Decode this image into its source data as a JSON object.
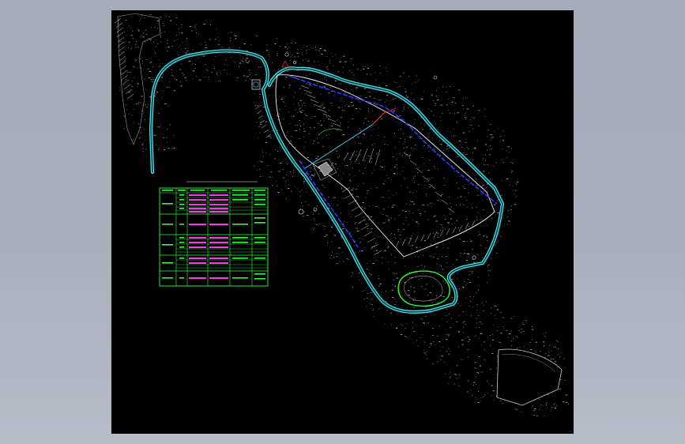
{
  "drawing": {
    "background": "#000000",
    "canvas_gradient": [
      "#a5abb8",
      "#b7bcc7"
    ],
    "colors": {
      "road": "#3fe3ea",
      "road_inner": "#1d6a7a",
      "drain": "#2a3cff",
      "terrain": "#d9d9d9",
      "table": "#2bff3a",
      "table_text": "#ff36f0",
      "red": "#ff2a2a"
    },
    "labels": {
      "table_title": "",
      "site_center": "",
      "site_main": "",
      "pond": "",
      "north_arrow": ""
    }
  },
  "table": {
    "rows": [
      {
        "cells": [
          "",
          "",
          "",
          "",
          "",
          ""
        ]
      },
      {
        "cells": [
          "",
          "",
          "",
          "",
          "",
          ""
        ]
      },
      {
        "cells": [
          "",
          "",
          "",
          "",
          "",
          ""
        ]
      },
      {
        "cells": [
          "",
          "",
          "",
          "",
          "",
          ""
        ]
      },
      {
        "cells": [
          "",
          "",
          "",
          "",
          "",
          ""
        ]
      },
      {
        "cells": [
          "",
          "",
          "",
          "",
          "",
          ""
        ]
      },
      {
        "cells": [
          "",
          "",
          "",
          "",
          "",
          ""
        ]
      }
    ]
  }
}
